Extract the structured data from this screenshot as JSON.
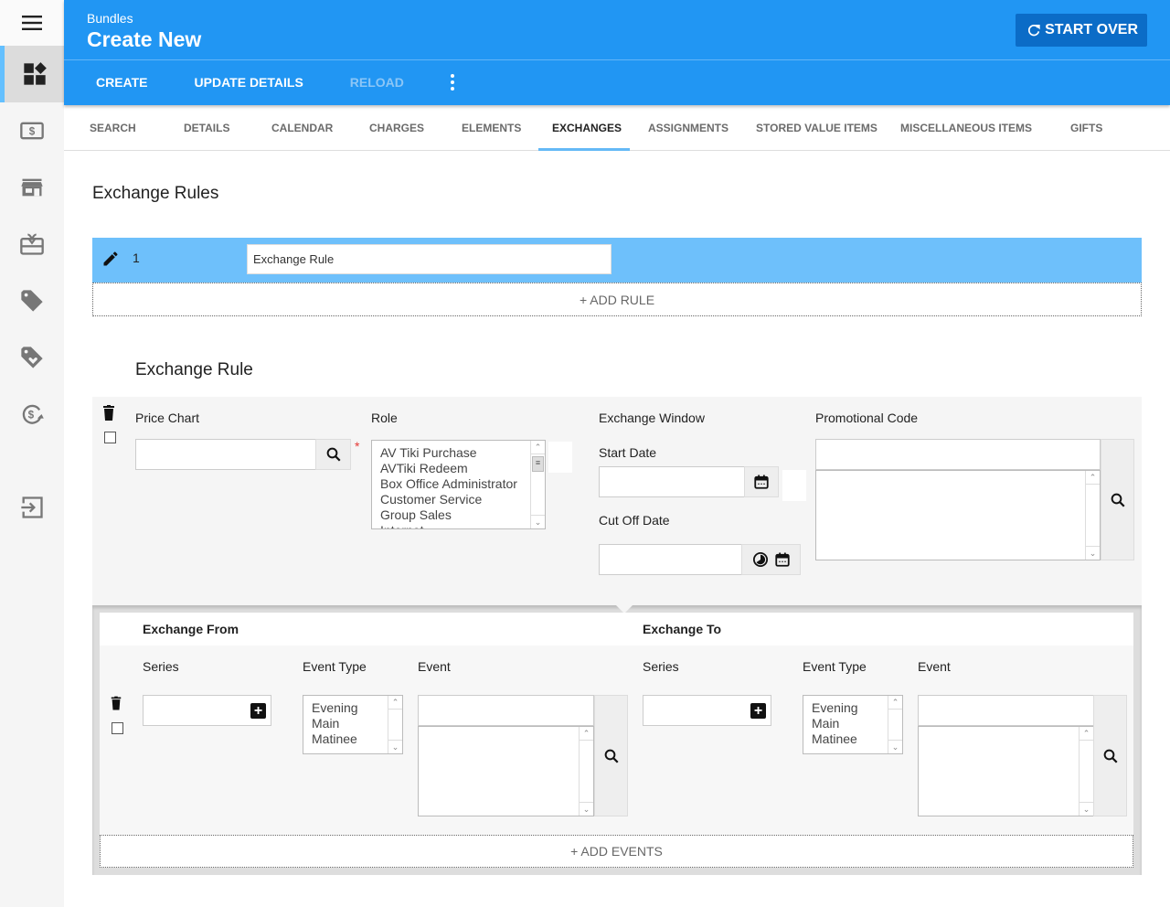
{
  "sidebar": {
    "menu_icon": "hamburger-menu-icon",
    "items": [
      {
        "icon": "bundles-icon",
        "active": true
      },
      {
        "icon": "money-icon",
        "active": false
      },
      {
        "icon": "store-icon",
        "active": false
      },
      {
        "icon": "gift-card-icon",
        "active": false
      },
      {
        "icon": "tag-icon",
        "active": false
      },
      {
        "icon": "tag-heart-icon",
        "active": false
      },
      {
        "icon": "currency-exchange-icon",
        "active": false
      },
      {
        "icon": "sign-in-icon",
        "active": false
      }
    ]
  },
  "header": {
    "breadcrumb": "Bundles",
    "title": "Create New",
    "start_over": "START OVER",
    "actions": {
      "create": "CREATE",
      "update_details": "UPDATE DETAILS",
      "reload": "RELOAD"
    }
  },
  "tabs": [
    {
      "label": "SEARCH"
    },
    {
      "label": "DETAILS"
    },
    {
      "label": "CALENDAR"
    },
    {
      "label": "CHARGES"
    },
    {
      "label": "ELEMENTS"
    },
    {
      "label": "EXCHANGES",
      "active": true
    },
    {
      "label": "ASSIGNMENTS"
    },
    {
      "label": "STORED VALUE ITEMS"
    },
    {
      "label": "MISCELLANEOUS ITEMS"
    },
    {
      "label": "GIFTS"
    }
  ],
  "exchange_rules": {
    "heading": "Exchange Rules",
    "rows": [
      {
        "number": "1",
        "name": "Exchange Rule"
      }
    ],
    "add_rule": "+ ADD RULE"
  },
  "exchange_rule": {
    "heading": "Exchange Rule",
    "price_chart": {
      "label": "Price Chart",
      "value": ""
    },
    "role": {
      "label": "Role",
      "required_marker": "*",
      "options": [
        "AV Tiki Purchase",
        "AVTiki Redeem",
        "Box Office Administrator",
        "Customer Service",
        "Group Sales",
        "Internet"
      ]
    },
    "exchange_window": {
      "label": "Exchange Window",
      "start_date": {
        "label": "Start Date",
        "value": ""
      },
      "cut_off_date": {
        "label": "Cut Off Date",
        "value": ""
      }
    },
    "promotional_code": {
      "label": "Promotional Code",
      "value": ""
    }
  },
  "exchange_from": {
    "heading": "Exchange From",
    "series_label": "Series",
    "event_type_label": "Event Type",
    "event_label": "Event",
    "event_type_options": [
      "Evening",
      "Main",
      "Matinee"
    ]
  },
  "exchange_to": {
    "heading": "Exchange To",
    "series_label": "Series",
    "event_type_label": "Event Type",
    "event_label": "Event",
    "event_type_options": [
      "Evening",
      "Main",
      "Matinee"
    ]
  },
  "add_events": "+ ADD EVENTS"
}
